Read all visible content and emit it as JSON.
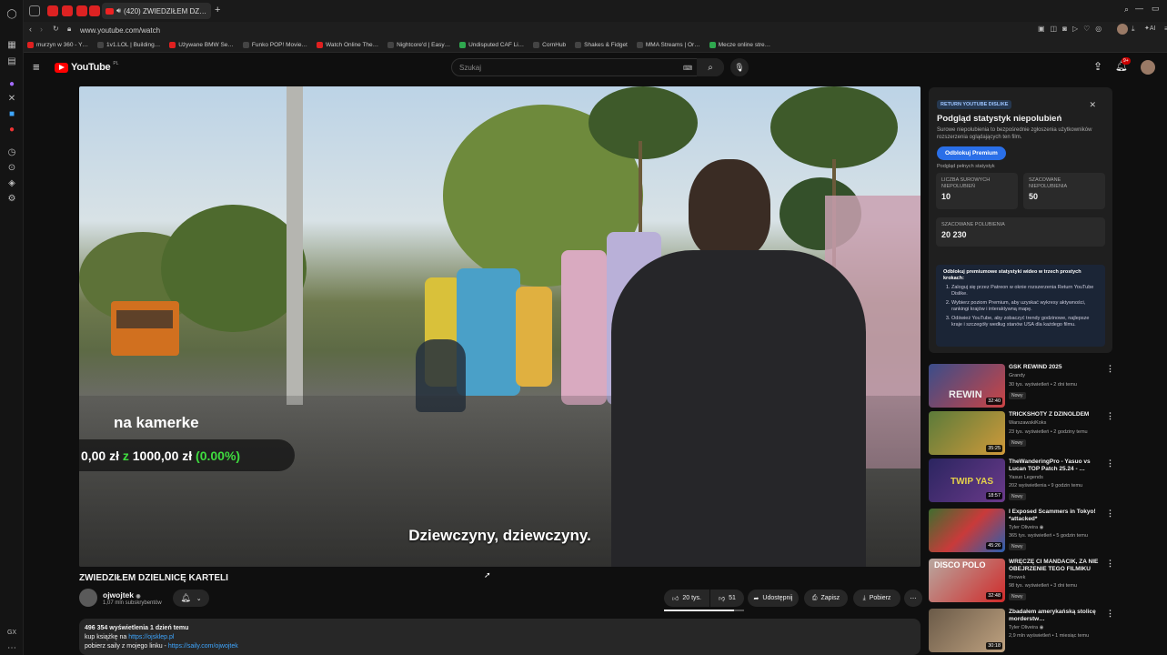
{
  "browser": {
    "active_tab_title": "(420) ZWIEDZIŁEM DZ…",
    "url": "www.youtube.com/watch",
    "bookmarks": [
      {
        "label": "murzyn w 360 - Y…",
        "color": "#e02020"
      },
      {
        "label": "1v1.LOL | Building…",
        "color": "#333333"
      },
      {
        "label": "Używane BMW Se…",
        "color": "#e02020"
      },
      {
        "label": "Funko POP! Movie…",
        "color": "#333333"
      },
      {
        "label": "Watch Online The…",
        "color": "#e02020"
      },
      {
        "label": "Nightcore'd | Easy…",
        "color": "#333333"
      },
      {
        "label": "Undisputed CAF Li…",
        "color": "#2fa84f"
      },
      {
        "label": "CornHub",
        "color": "#333333"
      },
      {
        "label": "Shakes & Fidget",
        "color": "#333333"
      },
      {
        "label": "MMA Streams | Or…",
        "color": "#333333"
      },
      {
        "label": "Mecze online stre…",
        "color": "#2fa84f"
      }
    ]
  },
  "youtube": {
    "logo_text": "YouTube",
    "region": "PL",
    "search_placeholder": "Szukaj",
    "notification_count": "9+"
  },
  "video": {
    "overlay_text": "na kamerke",
    "money_from": "0,00 zł",
    "money_sep": "z",
    "money_to": "1000,00 zł",
    "money_pct": "(0.00%)",
    "subtitle": "Dziewczyny, dziewczyny.",
    "title": "ZWIEDZIŁEM DZIELNICĘ KARTELI",
    "channel_name": "ojwojtek",
    "channel_subs": "1,07 mln subskrybentów",
    "likes": "20 tys.",
    "dislikes": "51",
    "like_ratio": 0.87,
    "share_label": "Udostępnij",
    "save_label": "Zapisz",
    "download_label": "Pobierz",
    "desc_stats": "496 354 wyświetlenia  1 dzień temu",
    "desc_line2_text": "kup książkę na ",
    "desc_line2_link": "https://ojsklep.pl",
    "desc_line3_text": "pobierz saily z mojego linku - ",
    "desc_line3_link": "https://saily.com/ojwojtek"
  },
  "ryd": {
    "badge": "RETURN YOUTUBE DISLIKE",
    "title": "Podgląd statystyk niepolubień",
    "subtitle": "Surowe niepolubienia to bezpośrednie zgłoszenia użytkowników rozszerzenia oglądających ten film.",
    "unlock_button": "Odblokuj Premium",
    "full_stats": "Podgląd pełnych statystyk",
    "raw_label": "LICZBA SUROWYCH NIEPOLUBIEŃ",
    "raw_value": "10",
    "est_dislikes_label": "SZACOWANE NIEPOLUBIENIA",
    "est_dislikes_value": "50",
    "est_likes_label": "SZACOWANE POLUBIENIA",
    "est_likes_value": "20 230",
    "steps_title": "Odblokuj premiumowe statystyki wideo w trzech prostych krokach:",
    "steps": [
      "Zaloguj się przez Patreon w oknie rozszerzenia Return YouTube Dislike.",
      "Wybierz poziom Premium, aby uzyskać wykresy aktywności, rankingi krajów i interaktywną mapę.",
      "Odśwież YouTube, aby zobaczyć trendy godzinowe, najlepsze kraje i szczegóły według stanów USA dla każdego filmu."
    ]
  },
  "recommendations": [
    {
      "title": "GSK REWIND 2025",
      "channel": "Grandy",
      "meta": "30 tys. wyświetleń • 2 dni temu",
      "duration": "32:40",
      "badge": "Nowy",
      "thumb": "#3a4d8a",
      "accent": "#d9d9d9"
    },
    {
      "title": "TRICKSHOTY Z DZINOLDEM",
      "channel": "WarszawskiKoks",
      "meta": "23 tys. wyświetleń • 2 godziny temu",
      "duration": "35:25",
      "badge": "Nowy",
      "thumb": "#5b7b3a",
      "accent": "#d09a3a"
    },
    {
      "title": "TheWanderingPro - Yasuo vs Lucan TOP Patch 25.24 - …",
      "channel": "Yasuo Legends",
      "meta": "202 wyświetlenia • 9 godzin temu",
      "duration": "18:57",
      "badge": "Nowy",
      "thumb": "#2b2560",
      "accent": "#e6d24a"
    },
    {
      "title": "I Exposed Scammers in Tokyo! *attacked*",
      "channel": "Tyler Oliveira",
      "meta": "365 tys. wyświetleń • 5 godzin temu",
      "duration": "45:26",
      "badge": "Nowy",
      "thumb": "#3f6e2f",
      "accent": "#c93a3a"
    },
    {
      "title": "WRĘCZĘ CI MANDACIK, ZA NIE OBEJRZENIE TEGO FILMIKU",
      "channel": "Browek",
      "meta": "98 tys. wyświetleń • 3 dni temu",
      "duration": "32:48",
      "badge": "Nowy",
      "thumb": "#b8a8a0",
      "accent": "#d02a2a"
    },
    {
      "title": "Zbadałem amerykańską stolicę morderstw…",
      "channel": "Tyler Oliveira",
      "meta": "2,9 mln wyświetleń • 1 miesiąc temu",
      "duration": "30:18",
      "badge": "",
      "thumb": "#6a5a48",
      "accent": "#bfa280"
    }
  ]
}
